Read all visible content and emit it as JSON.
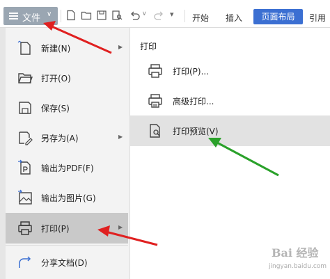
{
  "toolbar": {
    "file_menu_label": "文件",
    "tabs": [
      "开始",
      "插入",
      "页面布局",
      "引用"
    ],
    "active_tab": "页面布局"
  },
  "file_menu": {
    "items": [
      {
        "label": "新建(N)",
        "icon": "new-document-icon",
        "has_submenu": true
      },
      {
        "label": "打开(O)",
        "icon": "folder-open-icon",
        "has_submenu": false
      },
      {
        "label": "保存(S)",
        "icon": "save-icon",
        "has_submenu": false
      },
      {
        "label": "另存为(A)",
        "icon": "save-as-icon",
        "has_submenu": true
      },
      {
        "label": "输出为PDF(F)",
        "icon": "export-pdf-icon",
        "has_submenu": false
      },
      {
        "label": "输出为图片(G)",
        "icon": "export-image-icon",
        "has_submenu": false
      },
      {
        "label": "打印(P)",
        "icon": "printer-icon",
        "has_submenu": true,
        "selected": true
      },
      {
        "label": "分享文档(D)",
        "icon": "share-icon",
        "has_submenu": false
      }
    ]
  },
  "print_submenu": {
    "title": "打印",
    "items": [
      {
        "label": "打印(P)...",
        "icon": "printer-icon"
      },
      {
        "label": "高级打印...",
        "icon": "advanced-print-icon"
      },
      {
        "label": "打印预览(V)",
        "icon": "print-preview-icon",
        "highlighted": true
      }
    ]
  },
  "watermark": {
    "text": "Bai 经验",
    "url": "jingyan.baidu.com"
  },
  "colors": {
    "accent": "#3b6fd2",
    "file_button": "#9aa6b2",
    "selected_item": "#c9c9c9",
    "highlight_item": "#e2e2e2",
    "annotation_red": "#e02020",
    "annotation_green": "#2aa12a"
  }
}
